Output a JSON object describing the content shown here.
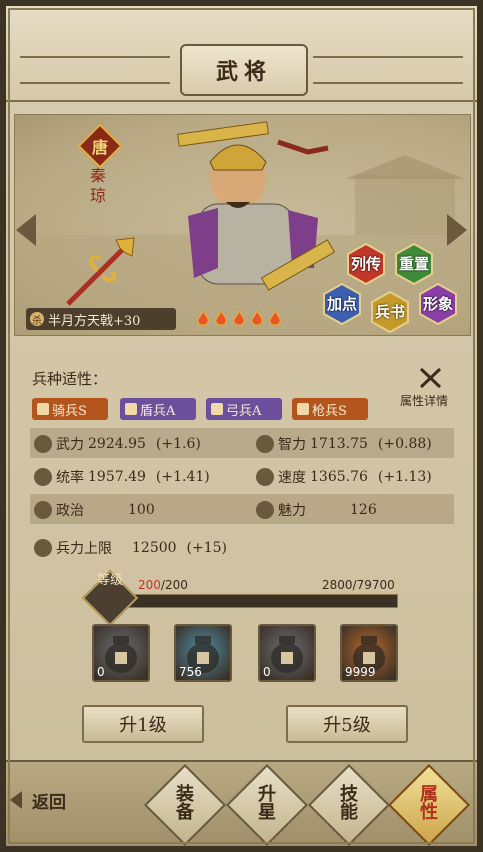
{
  "header": {
    "title": "武将"
  },
  "hero": {
    "faction": "唐",
    "name": "秦琼",
    "weapon": {
      "badge": "杀",
      "label": "半月方天戟+30"
    },
    "stars": 5
  },
  "actions": [
    {
      "label": "列传",
      "color": "#c0372a"
    },
    {
      "label": "重置",
      "color": "#3f8a3a"
    },
    {
      "label": "加点",
      "color": "#3d5fb0"
    },
    {
      "label": "兵书",
      "color": "#c49a2a"
    },
    {
      "label": "形象",
      "color": "#8a3fa6"
    }
  ],
  "troops": {
    "title": "兵种适性：",
    "detail_label": "属性详情",
    "tags": [
      {
        "label": "骑兵S",
        "color": "#b5551e"
      },
      {
        "label": "盾兵A",
        "color": "#6b4e9c"
      },
      {
        "label": "弓兵A",
        "color": "#6b4e9c"
      },
      {
        "label": "枪兵S",
        "color": "#b5551e"
      }
    ]
  },
  "stats": {
    "force": {
      "label": "武力",
      "value": "2924.95",
      "bonus": "(+1.6)"
    },
    "intel": {
      "label": "智力",
      "value": "1713.75",
      "bonus": "(+0.88)"
    },
    "command": {
      "label": "统率",
      "value": "1957.49",
      "bonus": "(+1.41)"
    },
    "speed": {
      "label": "速度",
      "value": "1365.76",
      "bonus": "(+1.13)"
    },
    "politics": {
      "label": "政治",
      "value": "100"
    },
    "charm": {
      "label": "魅力",
      "value": "126"
    },
    "troop_cap": {
      "label": "兵力上限",
      "value": "12500",
      "bonus": "(+15)"
    }
  },
  "level": {
    "label": "等级",
    "current": "200",
    "max": "/200",
    "exp": "2800/79700",
    "exp_fraction": 0.035
  },
  "items": [
    {
      "count": "0",
      "color": "#6b6f75"
    },
    {
      "count": "756",
      "color": "#4d8fa6"
    },
    {
      "count": "0",
      "color": "#6b6f75"
    },
    {
      "count": "9999",
      "color": "#b8692b"
    }
  ],
  "buttons": {
    "up1": "升1级",
    "up5": "升5级"
  },
  "nav": {
    "back": "返回",
    "tabs": [
      {
        "label": "装备",
        "active": false
      },
      {
        "label": "升星",
        "active": false
      },
      {
        "label": "技能",
        "active": false
      },
      {
        "label": "属性",
        "active": true
      }
    ]
  },
  "colors": {
    "accent_red": "#b0311c",
    "level_red": "#c0392b"
  }
}
